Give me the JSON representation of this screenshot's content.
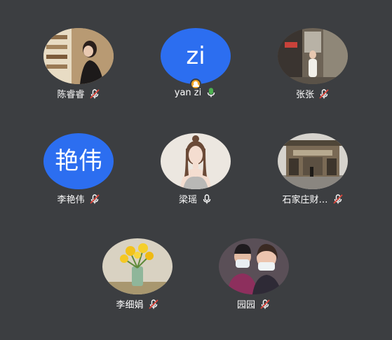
{
  "participants": [
    {
      "name": "陈睿睿",
      "mic": "muted",
      "avatar": "photo-bookstore-woman"
    },
    {
      "name": "yan zi",
      "mic": "active",
      "avatar_text": "zi",
      "host": true
    },
    {
      "name": "张张",
      "mic": "muted",
      "avatar": "photo-street-woman"
    },
    {
      "name": "李艳伟",
      "mic": "muted",
      "avatar_text": "艳伟"
    },
    {
      "name": "梁瑶",
      "mic": "on",
      "avatar": "illustration-girl"
    },
    {
      "name": "石家庄财…",
      "mic": "muted",
      "avatar": "photo-building-gate"
    },
    {
      "name": "李细娟",
      "mic": "muted",
      "avatar": "photo-yellow-flowers"
    },
    {
      "name": "园园",
      "mic": "muted",
      "avatar": "photo-two-people-masks"
    }
  ],
  "colors": {
    "background": "#3c3e41",
    "avatar_blue": "#2c6ef0",
    "mic_active": "#4caf50",
    "mic_muted_slash": "#e0463c",
    "host_badge": "#f5a623"
  }
}
